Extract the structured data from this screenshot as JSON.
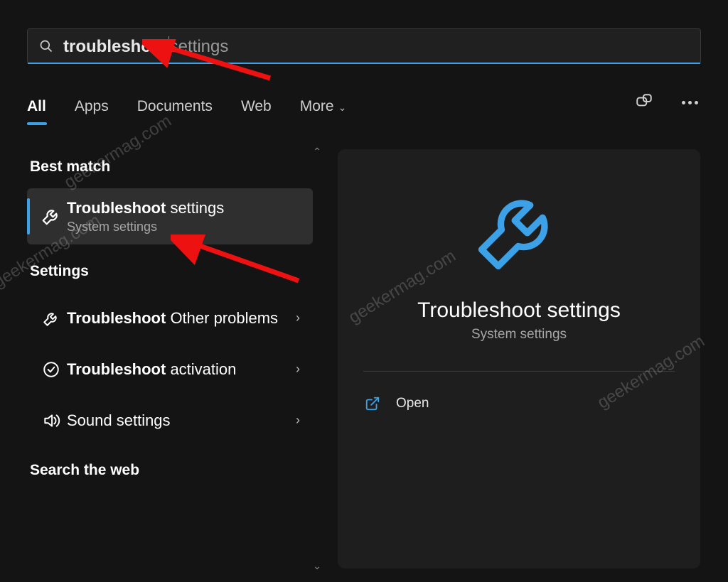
{
  "search": {
    "query_bold": "troubleshoot",
    "query_light": "settings"
  },
  "tabs": {
    "all": "All",
    "apps": "Apps",
    "documents": "Documents",
    "web": "Web",
    "more": "More"
  },
  "sections": {
    "best_match": "Best match",
    "settings": "Settings",
    "search_web": "Search the web"
  },
  "best_match_item": {
    "title_bold": "Troubleshoot",
    "title_rest": " settings",
    "subtitle": "System settings"
  },
  "settings_items": [
    {
      "title_bold": "Troubleshoot",
      "title_rest": " Other problems",
      "icon": "wrench"
    },
    {
      "title_bold": "Troubleshoot",
      "title_rest": " activation",
      "icon": "check-circle"
    },
    {
      "title_bold": "",
      "title_rest": "Sound settings",
      "icon": "sound"
    }
  ],
  "detail": {
    "title": "Troubleshoot settings",
    "subtitle": "System settings",
    "open_label": "Open"
  },
  "watermark_text": "geekermag.com"
}
